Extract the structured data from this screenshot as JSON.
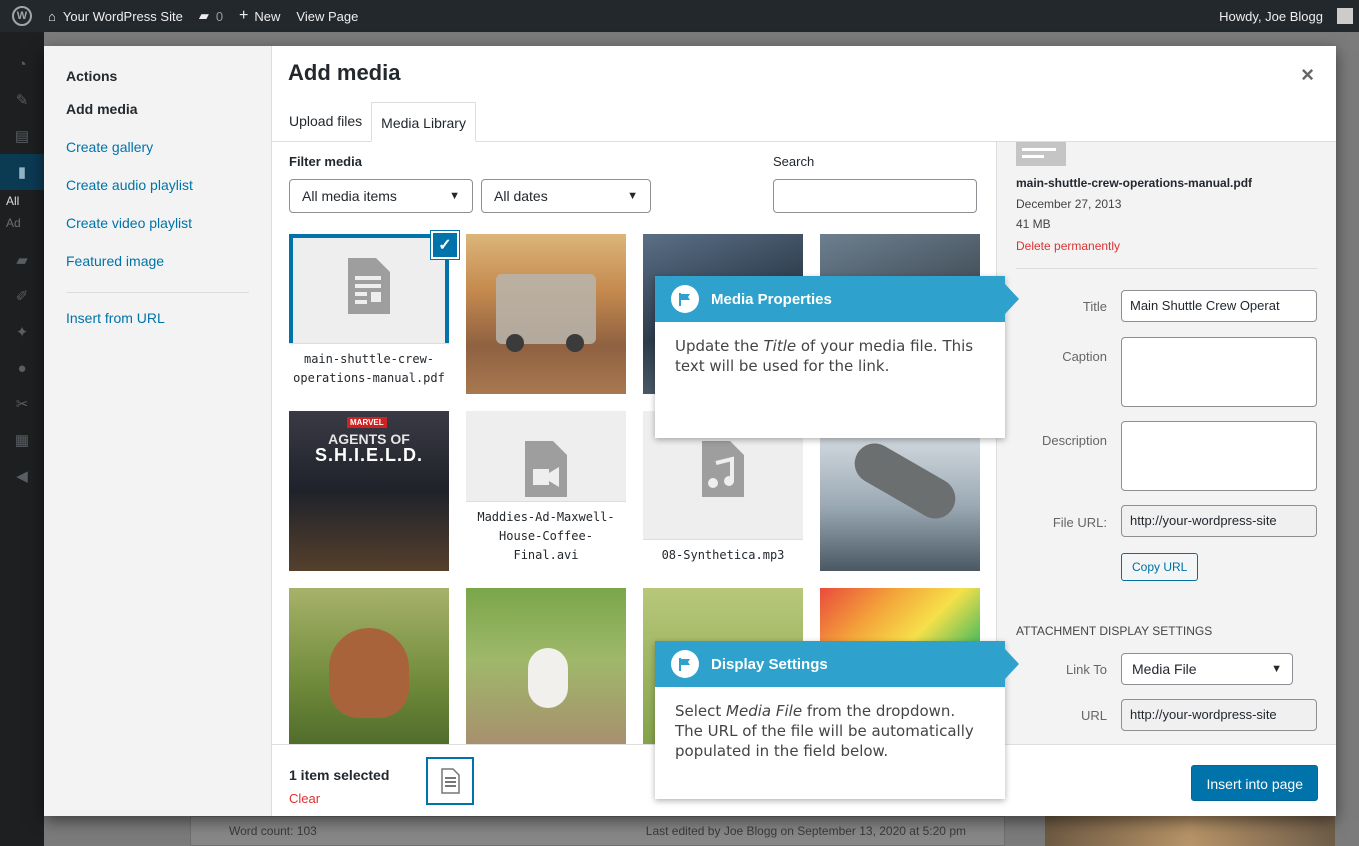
{
  "adminbar": {
    "site_name": "Your WordPress Site",
    "comments_count": "0",
    "new_label": "New",
    "view_label": "View Page",
    "greeting": "Howdy, Joe Blogg"
  },
  "admin_menu": {
    "sub1": "All",
    "sub2": "Ad"
  },
  "background": {
    "word_count": "Word count: 103",
    "last_edited": "Last edited by Joe Blogg on September 13, 2020 at 5:20 pm"
  },
  "modal": {
    "title": "Add media",
    "close_symbol": "×",
    "tabs": [
      {
        "label": "Upload files"
      },
      {
        "label": "Media Library"
      }
    ]
  },
  "menu": {
    "heading": "Actions",
    "items": [
      {
        "label": "Add media"
      },
      {
        "label": "Create gallery"
      },
      {
        "label": "Create audio playlist"
      },
      {
        "label": "Create video playlist"
      },
      {
        "label": "Featured image"
      },
      {
        "label": "Insert from URL"
      }
    ]
  },
  "filter": {
    "label": "Filter media",
    "type_value": "All media items",
    "date_value": "All dates",
    "search_label": "Search"
  },
  "media_items": [
    {
      "name": "main-shuttle-crew-operations-manual.pdf",
      "kind": "document",
      "selected": true
    },
    {
      "kind": "image",
      "subject": "mars-rover"
    },
    {
      "kind": "image",
      "subject": "thor"
    },
    {
      "kind": "image",
      "subject": "iron-man"
    },
    {
      "kind": "image",
      "subject": "agents-of-shield-poster",
      "poster_brand": "MARVEL",
      "poster_line1": "AGENTS OF",
      "poster_line2": "S.H.I.E.L.D."
    },
    {
      "name": "Maddies-Ad-Maxwell-House-Coffee-Final.avi",
      "kind": "video"
    },
    {
      "name": "08-Synthetica.mp3",
      "kind": "audio"
    },
    {
      "kind": "image",
      "subject": "spaceship"
    },
    {
      "kind": "image",
      "subject": "puppy"
    },
    {
      "kind": "image",
      "subject": "kitten"
    },
    {
      "kind": "image",
      "subject": "bulldog"
    },
    {
      "kind": "image",
      "subject": "colored-pencils"
    }
  ],
  "selection": {
    "count_label": "1 item selected",
    "clear_label": "Clear"
  },
  "insert_label": "Insert into page",
  "details": {
    "filename": "main-shuttle-crew-operations-manual.pdf",
    "date": "December 27, 2013",
    "size": "41 MB",
    "delete_label": "Delete permanently",
    "title_label": "Title",
    "title_value": "Main Shuttle Crew Operat",
    "caption_label": "Caption",
    "description_label": "Description",
    "file_url_label": "File URL:",
    "file_url_value": "http://your-wordpress-site",
    "copy_url_label": "Copy URL",
    "display_settings_heading": "Attachment Display Settings",
    "link_to_label": "Link To",
    "link_to_value": "Media File",
    "url_label": "URL",
    "url_value": "http://your-wordpress-site"
  },
  "callouts": {
    "properties": {
      "title": "Media Properties",
      "text_1": "Update the ",
      "text_em": "Title",
      "text_2": " of your media file. This text will be used for the link."
    },
    "display": {
      "title": "Display Settings",
      "text_1": "Select ",
      "text_em": "Media File",
      "text_2": " from the dropdown. The URL of the file will be automatically populated in the field below."
    }
  },
  "colors": {
    "accent": "#0073aa",
    "callout": "#2ea2cc",
    "danger": "#dc3232",
    "adminbar": "#23282d"
  }
}
